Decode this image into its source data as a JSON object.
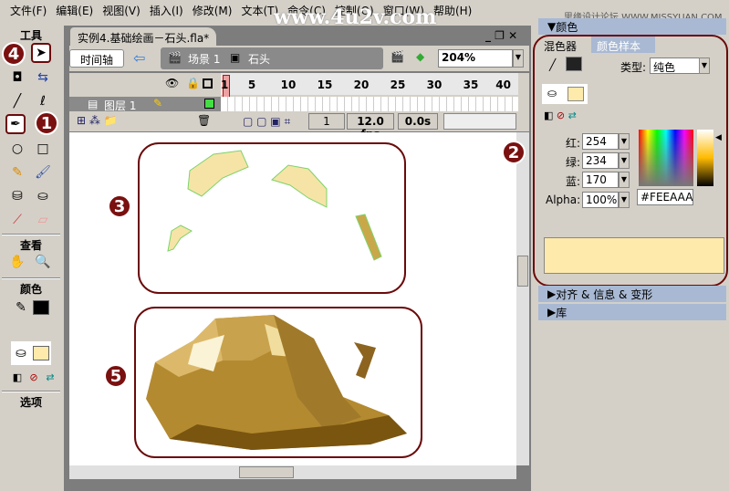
{
  "menu": [
    "文件(F)",
    "编辑(E)",
    "视图(V)",
    "插入(I)",
    "修改(M)",
    "文本(T)",
    "命令(C)",
    "控制(O)",
    "窗口(W)",
    "帮助(H)"
  ],
  "watermark": "www.4u2v.com",
  "watermark2": "思缘设计论坛 WWW.MISSYUAN.COM",
  "tools": {
    "title": "工具",
    "view_title": "查看",
    "color_title": "颜色",
    "options_title": "选项"
  },
  "badges": {
    "b1": "1",
    "b2": "2",
    "b3": "3",
    "b4": "4",
    "b5": "5"
  },
  "document": {
    "tab": "实例4.基础绘画－石头.fla*",
    "timeline_btn": "时间轴",
    "scene": "场景 1",
    "symbol": "石头",
    "zoom": "204%"
  },
  "timeline": {
    "layer": "图层 1",
    "frames": [
      "1",
      "5",
      "10",
      "15",
      "20",
      "25",
      "30",
      "35",
      "40"
    ],
    "current_frame": "1",
    "fps": "12.0 fps",
    "time": "0.0s"
  },
  "panel": {
    "title": "颜色",
    "tab_mixer": "混色器",
    "tab_swatches": "颜色样本",
    "type_label": "类型:",
    "type_value": "纯色",
    "red_label": "红:",
    "red": "254",
    "green_label": "绿:",
    "green": "234",
    "blue_label": "蓝:",
    "blue": "170",
    "alpha_label": "Alpha:",
    "alpha": "100%",
    "hex": "#FEEAAA",
    "align_panel": "对齐 & 信息 & 变形",
    "library_panel": "库"
  },
  "colors": {
    "fill": "#FEEAAA",
    "stroke": "#000000",
    "accent": "#6a0a0a"
  }
}
